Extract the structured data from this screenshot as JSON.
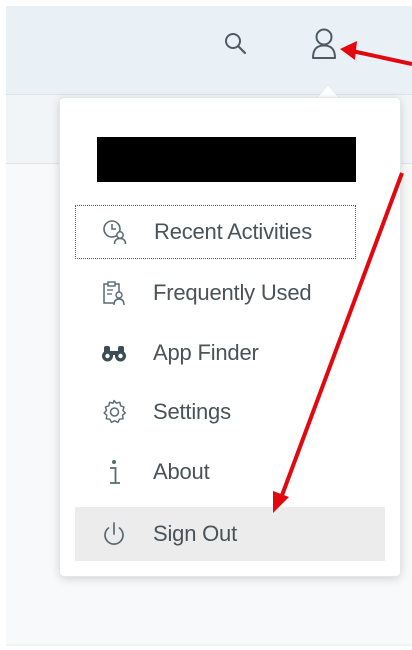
{
  "header": {
    "search_icon": "search-icon",
    "user_icon": "user-icon"
  },
  "user_menu": {
    "user_name": "",
    "items": [
      {
        "label": "Recent Activities",
        "icon": "recent-activities-icon"
      },
      {
        "label": "Frequently Used",
        "icon": "frequently-used-icon"
      },
      {
        "label": "App Finder",
        "icon": "binoculars-icon"
      },
      {
        "label": "Settings",
        "icon": "gear-icon"
      },
      {
        "label": "About",
        "icon": "info-icon"
      },
      {
        "label": "Sign Out",
        "icon": "power-icon"
      }
    ]
  },
  "annotation_color": "#e2080f",
  "icon_color": "#5a6a73",
  "accent_icon_color": "#3d4d56"
}
